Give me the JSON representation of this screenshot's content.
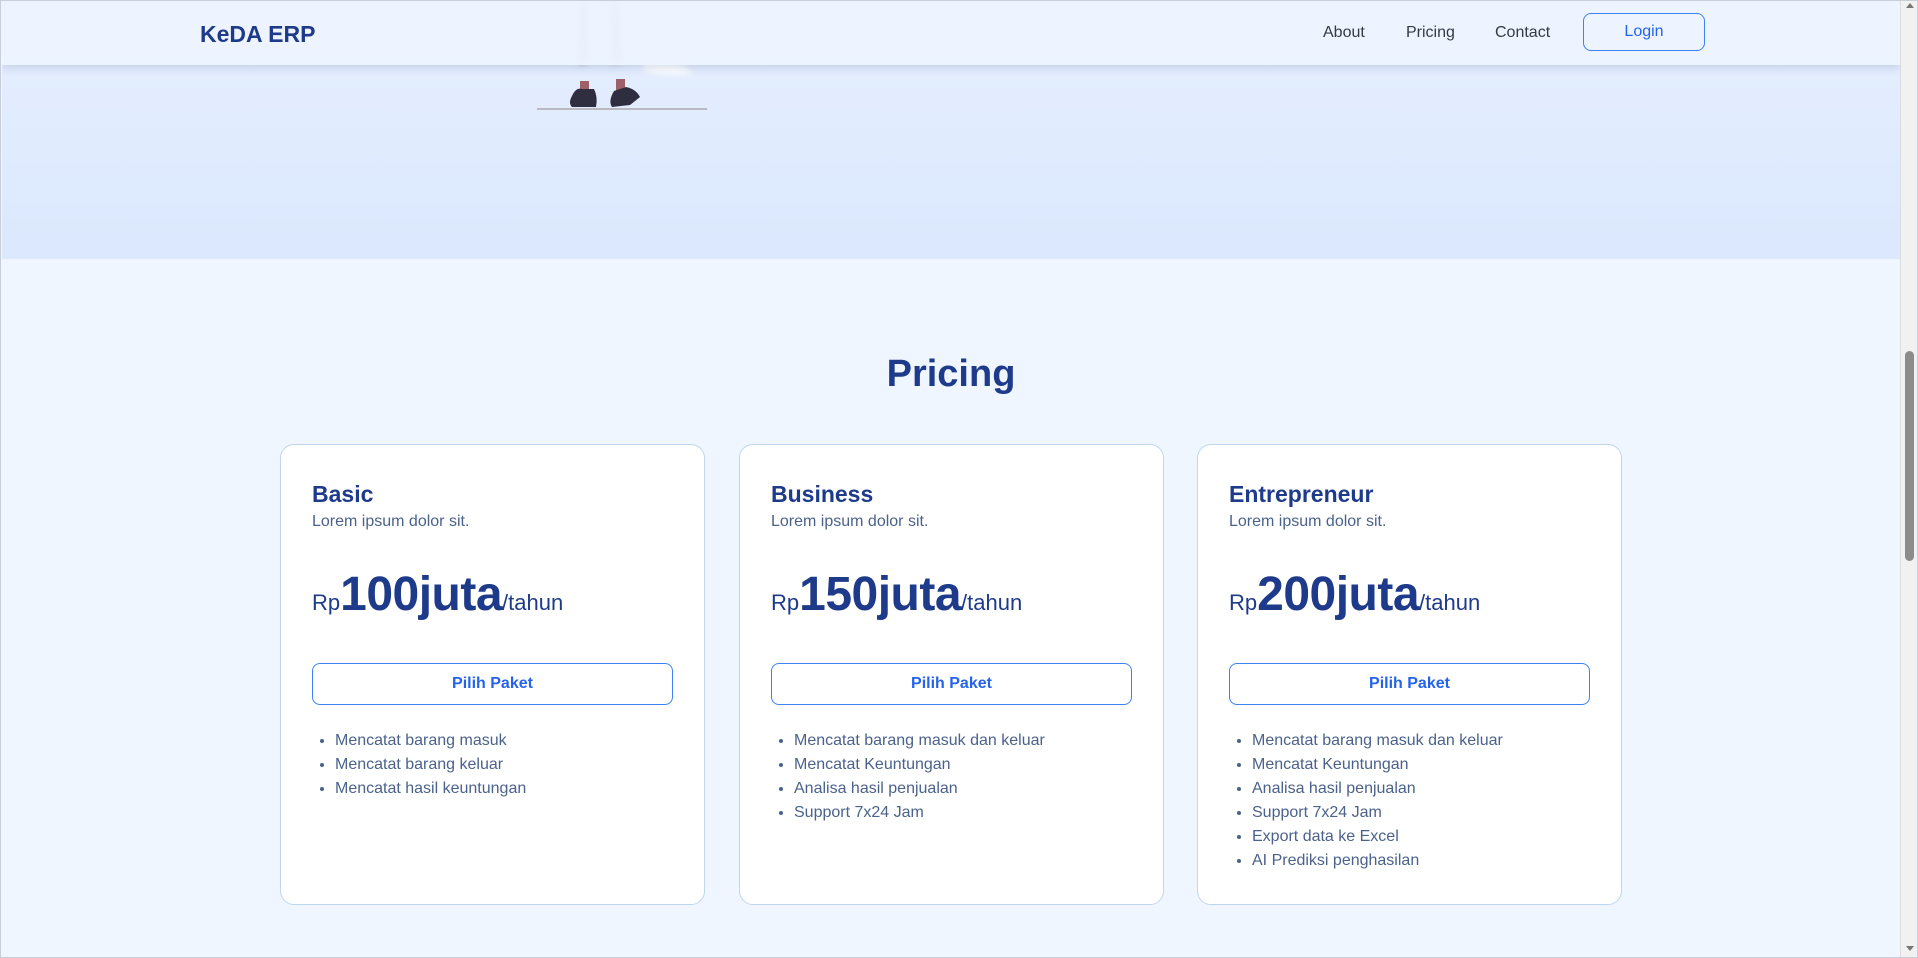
{
  "navbar": {
    "brand": "KeDA ERP",
    "links": [
      "About",
      "Pricing",
      "Contact"
    ],
    "login_label": "Login"
  },
  "pricing": {
    "title": "Pricing",
    "plans": [
      {
        "name": "Basic",
        "description": "Lorem ipsum dolor sit.",
        "currency": "Rp",
        "amount": "100juta",
        "period": "/tahun",
        "button_label": "Pilih Paket",
        "features": [
          "Mencatat barang masuk",
          "Mencatat barang keluar",
          "Mencatat hasil keuntungan"
        ]
      },
      {
        "name": "Business",
        "description": "Lorem ipsum dolor sit.",
        "currency": "Rp",
        "amount": "150juta",
        "period": "/tahun",
        "button_label": "Pilih Paket",
        "features": [
          "Mencatat barang masuk dan keluar",
          "Mencatat Keuntungan",
          "Analisa hasil penjualan",
          "Support 7x24 Jam"
        ]
      },
      {
        "name": "Entrepreneur",
        "description": "Lorem ipsum dolor sit.",
        "currency": "Rp",
        "amount": "200juta",
        "period": "/tahun",
        "button_label": "Pilih Paket",
        "features": [
          "Mencatat barang masuk dan keluar",
          "Mencatat Keuntungan",
          "Analisa hasil penjualan",
          "Support 7x24 Jam",
          "Export data ke Excel",
          "AI Prediksi penghasilan"
        ]
      }
    ]
  },
  "colors": {
    "brand": "#1e3a8a",
    "accent": "#3b82f6",
    "page_background": "#eff6ff",
    "hero_background": "#dbe8fd"
  },
  "icons": [
    "hero-illustration",
    "scroll-up-arrow-icon",
    "scroll-down-arrow-icon"
  ]
}
